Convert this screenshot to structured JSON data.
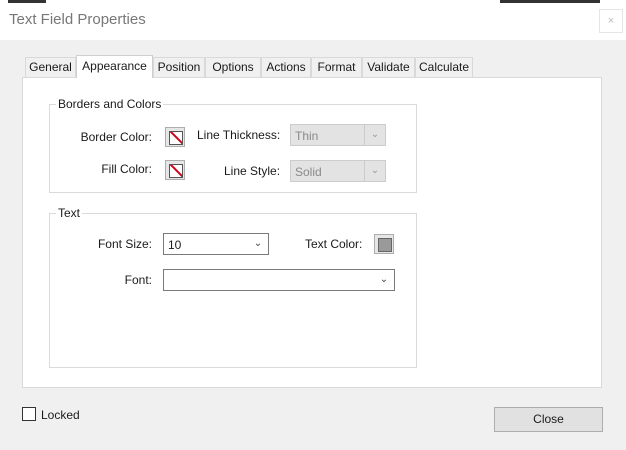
{
  "window": {
    "title": "Text Field Properties",
    "close_label": "×"
  },
  "tabs": [
    {
      "label": "General"
    },
    {
      "label": "Appearance"
    },
    {
      "label": "Position"
    },
    {
      "label": "Options"
    },
    {
      "label": "Actions"
    },
    {
      "label": "Format"
    },
    {
      "label": "Validate"
    },
    {
      "label": "Calculate"
    }
  ],
  "active_tab": "Appearance",
  "borders_colors": {
    "title": "Borders and Colors",
    "border_color_label": "Border Color:",
    "fill_color_label": "Fill Color:",
    "line_thickness_label": "Line Thickness:",
    "line_thickness_value": "Thin",
    "line_style_label": "Line Style:",
    "line_style_value": "Solid"
  },
  "text_group": {
    "title": "Text",
    "font_size_label": "Font Size:",
    "font_size_value": "10",
    "text_color_label": "Text Color:",
    "font_label": "Font:",
    "font_value": ""
  },
  "footer": {
    "locked_label": "Locked",
    "close_button": "Close"
  },
  "icons": {
    "dropdown": "chevron-down-icon",
    "window_close": "close-icon"
  }
}
